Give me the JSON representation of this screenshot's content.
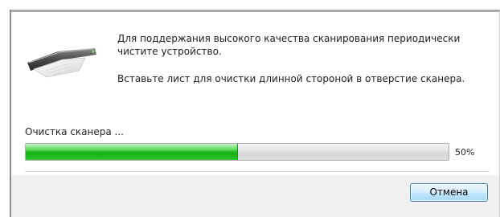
{
  "dialog": {
    "message_line1": "Для поддержания высокого качества сканирования периодически чистите устройство.",
    "message_line2": "Вставьте лист для очистки длинной стороной в отверстие сканера.",
    "status_label": "Очистка сканера ...",
    "progress": {
      "value": 0.5,
      "percent_text": "50%"
    },
    "cancel_label": "Отмена",
    "icon": "scanner-icon"
  },
  "colors": {
    "progress_fill": "#14b014",
    "progress_track": "#e0e0e0",
    "button_border": "#3c7fb1",
    "footer_bg": "#f0f0f0"
  }
}
